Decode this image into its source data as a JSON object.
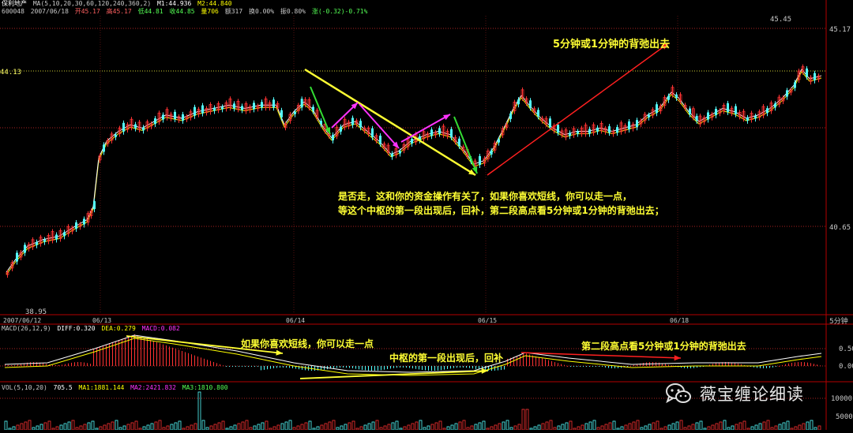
{
  "header": {
    "row1": {
      "name": "保利地产",
      "ma_label": "MA(5,10,20,30,60,120,240,360,2)",
      "m1": "M1:44.936",
      "m2": "M2:44.840"
    },
    "row2": {
      "code": "600048",
      "date": "2007/06/18",
      "open": "开45.17",
      "high": "高45.17",
      "low": "低44.81",
      "close": "收44.85",
      "vol": "量706",
      "amount": "额317",
      "turnover": "换0.00%",
      "amplitude": "振0.80%",
      "change": "涨(-0.32)-0.71%"
    }
  },
  "macd_header": {
    "label": "MACD(26,12,9)",
    "diff": "DIFF:0.320",
    "dea": "DEA:0.279",
    "macd": "MACD:0.082"
  },
  "vol_header": {
    "label": "VOL(5,10,20)",
    "value": "705.5",
    "ma1": "MA1:1881.144",
    "ma2": "MA2:2421.832",
    "ma3": "MA3:1810.800"
  },
  "period": "5分钟",
  "annotations": {
    "top": "5分钟或1分钟的背弛出去",
    "middle_line1": "是否走，这和你的资金操作有关了，如果你喜欢短线，你可以走一点，",
    "middle_line2": "等这个中枢的第一段出现后，回补，第二段高点看5分钟或1分钟的背弛出去；",
    "macd_1": "如果你喜欢短线，你可以走一点",
    "macd_2": "中枢的第一段出现后，回补",
    "macd_3": "第二段高点看5分钟或1分钟的背弛出去"
  },
  "watermark": {
    "text": "薇宝缠论细读",
    "icon": "wechat-icon"
  },
  "colors": {
    "up": "#ff3232",
    "down": "#54ffff",
    "axis": "#b40000",
    "label": "#c8c8c8",
    "annotation_yellow": "#ffff33",
    "ma1": "#ffffff",
    "ma2": "#ffff00",
    "green_arrow": "#33dd33",
    "magenta_arrow": "#ff33ff",
    "red_arrow": "#ff2020"
  },
  "chart_data": [
    {
      "type": "candlestick",
      "x": [
        "2007/06/12",
        "06/13",
        "06/14",
        "06/15",
        "06/18"
      ],
      "ylim": [
        37.8,
        46.9
      ],
      "y_ticks": [
        45.17,
        40.65
      ],
      "price_marks": {
        "high": "45.45",
        "low": "38.95",
        "level": "44.13"
      },
      "series": [
        {
          "name": "M1",
          "values": [
            44.936
          ]
        },
        {
          "name": "M2",
          "values": [
            44.84
          ]
        }
      ],
      "last_bar": {
        "date": "2007/06/18",
        "open": 45.17,
        "high": 45.17,
        "low": 44.81,
        "close": 44.85,
        "volume": 706
      }
    },
    {
      "type": "bar",
      "name": "MACD(26,12,9)",
      "series": [
        {
          "name": "DIFF",
          "values": [
            0.32
          ]
        },
        {
          "name": "DEA",
          "values": [
            0.279
          ]
        },
        {
          "name": "MACD",
          "values": [
            0.082
          ]
        }
      ],
      "y_ticks": [
        "0.50",
        "0.00"
      ]
    },
    {
      "type": "bar",
      "name": "VOL(5,10,20)",
      "series": [
        {
          "name": "VOL",
          "values": [
            705.5
          ]
        },
        {
          "name": "MA1",
          "values": [
            1881.144
          ]
        },
        {
          "name": "MA2",
          "values": [
            2421.832
          ]
        },
        {
          "name": "MA3",
          "values": [
            1810.8
          ]
        }
      ],
      "y_ticks": [
        "10000",
        "5000"
      ]
    }
  ]
}
